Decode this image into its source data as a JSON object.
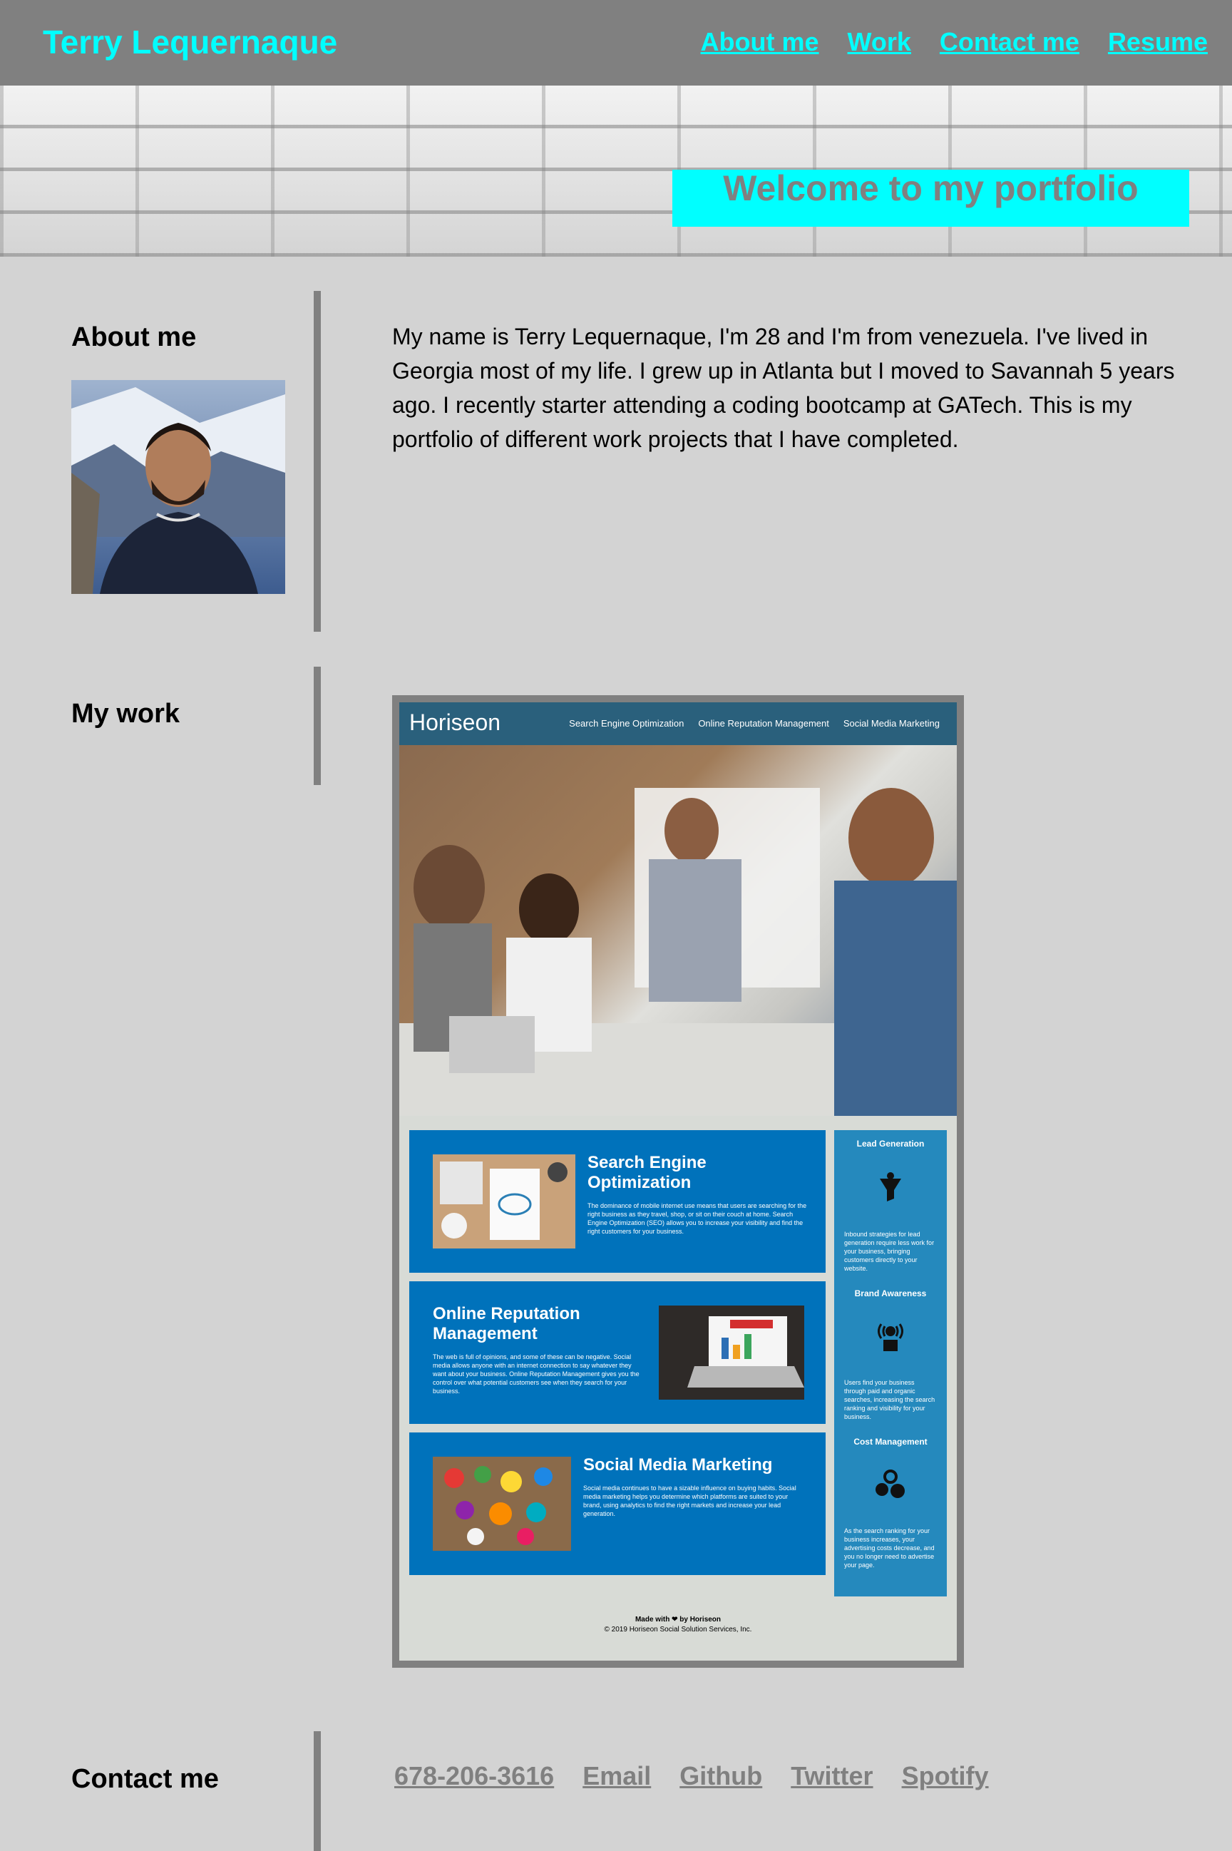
{
  "header": {
    "brand": "Terry Lequernaque",
    "nav": [
      "About me",
      "Work",
      "Contact me",
      "Resume"
    ]
  },
  "hero": {
    "welcome": "Welcome to my portfolio"
  },
  "about": {
    "title": "About me",
    "text": "My name is Terry Lequernaque, I'm 28 and I'm from venezuela. I've lived in Georgia most of my life. I grew up in Atlanta but I moved to Savannah 5 years ago. I recently starter attending a coding bootcamp at GATech. This is my portfolio of different work projects that I have completed."
  },
  "work": {
    "title": "My work",
    "project": {
      "logo": "Horiseon",
      "nav": [
        "Search Engine Optimization",
        "Online Reputation Management",
        "Social Media Marketing"
      ],
      "cards": [
        {
          "title": "Search Engine Optimization",
          "text": "The dominance of mobile internet use means that users are searching for the right business as they travel, shop, or sit on their couch at home. Search Engine Optimization (SEO) allows you to increase your visibility and find the right customers for your business."
        },
        {
          "title": "Online Reputation Management",
          "text": "The web is full of opinions, and some of these can be negative. Social media allows anyone with an internet connection to say whatever they want about your business. Online Reputation Management gives you the control over what potential customers see when they search for your business."
        },
        {
          "title": "Social Media Marketing",
          "text": "Social media continues to have a sizable influence on buying habits. Social media marketing helps you determine which platforms are suited to your brand, using analytics to find the right markets and increase your lead generation."
        }
      ],
      "sidebar": [
        {
          "title": "Lead Generation",
          "text": "Inbound strategies for lead generation require less work for your business, bringing customers directly to your website."
        },
        {
          "title": "Brand Awareness",
          "text": "Users find your business through paid and organic searches, increasing the search ranking and visibility for your business."
        },
        {
          "title": "Cost Management",
          "text": "As the search ranking for your business increases, your advertising costs decrease, and you no longer need to advertise your page."
        }
      ],
      "footer": {
        "made_with": "Made with ❤ by Horiseon",
        "copyright": "© 2019 Horiseon Social Solution Services, Inc."
      }
    }
  },
  "contact": {
    "title": "Contact me",
    "links": [
      "678-206-3616",
      "Email",
      "Github",
      "Twitter",
      "Spotify"
    ]
  },
  "colors": {
    "accent": "#00ffff",
    "header_bg": "#808080",
    "page_bg": "#d3d3d3"
  }
}
